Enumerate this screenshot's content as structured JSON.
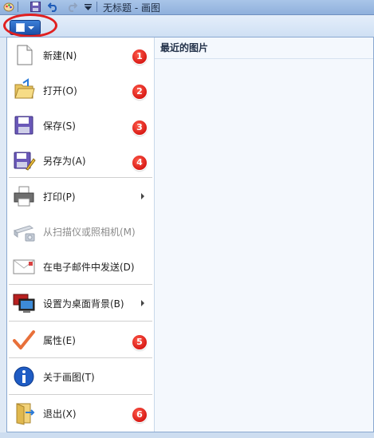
{
  "window": {
    "title": "无标题 - 画图"
  },
  "ribbon": {
    "app_button_icon": "paint-menu-icon"
  },
  "menu": {
    "items": [
      {
        "label": "新建(N)",
        "icon": "new-document-icon",
        "badge": "1"
      },
      {
        "label": "打开(O)",
        "icon": "open-folder-icon",
        "badge": "2"
      },
      {
        "label": "保存(S)",
        "icon": "save-floppy-icon",
        "badge": "3"
      },
      {
        "label": "另存为(A)",
        "icon": "save-as-icon",
        "badge": "4"
      },
      {
        "label": "打印(P)",
        "icon": "printer-icon"
      },
      {
        "label": "从扫描仪或照相机(M)",
        "icon": "scanner-icon"
      },
      {
        "label": "在电子邮件中发送(D)",
        "icon": "email-icon"
      },
      {
        "label": "设置为桌面背景(B)",
        "icon": "desktop-icon"
      },
      {
        "label": "属性(E)",
        "icon": "checkmark-icon",
        "badge": "5"
      },
      {
        "label": "关于画图(T)",
        "icon": "info-icon"
      },
      {
        "label": "退出(X)",
        "icon": "exit-icon",
        "badge": "6"
      }
    ],
    "recent_title": "最近的图片"
  },
  "colors": {
    "accent": "#1c4fa6",
    "badge": "#d00000",
    "highlight_oval": "#e02020"
  }
}
